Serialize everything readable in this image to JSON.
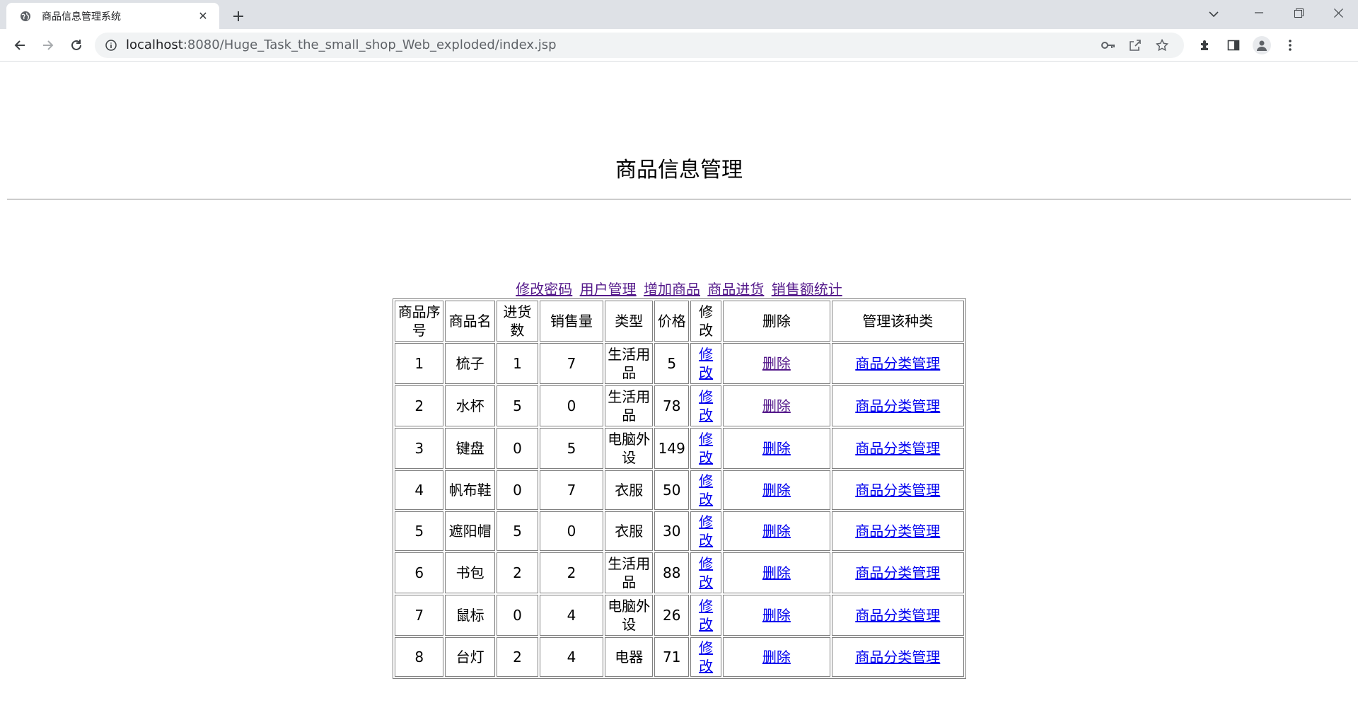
{
  "browser": {
    "tab_title": "商品信息管理系统",
    "url_host": "localhost",
    "url_rest": ":8080/Huge_Task_the_small_shop_Web_exploded/index.jsp",
    "icons": [
      "globe-icon",
      "close-icon",
      "plus-icon",
      "chevron-down-icon",
      "minimize-icon",
      "restore-icon",
      "close-window-icon",
      "back-arrow-icon",
      "forward-arrow-icon",
      "reload-icon",
      "info-icon",
      "key-icon",
      "share-icon",
      "star-icon",
      "extensions-icon",
      "side-panel-icon",
      "profile-icon",
      "kebab-menu-icon"
    ]
  },
  "page": {
    "title": "商品信息管理",
    "links": {
      "change_password": "修改密码",
      "user_management": "用户管理",
      "add_goods": "增加商品",
      "goods_purchase": "商品进货",
      "sales_stats": "销售额统计"
    },
    "table": {
      "headers": {
        "id": "商品序号",
        "name": "商品名",
        "purchase": "进货数",
        "sales": "销售量",
        "type": "类型",
        "price": "价格",
        "edit": "修改",
        "delete": "删除",
        "manage": "管理该种类"
      },
      "rows": [
        {
          "id": "1",
          "name": "梳子",
          "purchase": "1",
          "sales": "7",
          "type": "生活用品",
          "price": "5",
          "edit": "修改",
          "delete": "删除",
          "manage": "商品分类管理"
        },
        {
          "id": "2",
          "name": "水杯",
          "purchase": "5",
          "sales": "0",
          "type": "生活用品",
          "price": "78",
          "edit": "修改",
          "delete": "删除",
          "manage": "商品分类管理"
        },
        {
          "id": "3",
          "name": "键盘",
          "purchase": "0",
          "sales": "5",
          "type": "电脑外设",
          "price": "149",
          "edit": "修改",
          "delete": "删除",
          "manage": "商品分类管理"
        },
        {
          "id": "4",
          "name": "帆布鞋",
          "purchase": "0",
          "sales": "7",
          "type": "衣服",
          "price": "50",
          "edit": "修改",
          "delete": "删除",
          "manage": "商品分类管理"
        },
        {
          "id": "5",
          "name": "遮阳帽",
          "purchase": "5",
          "sales": "0",
          "type": "衣服",
          "price": "30",
          "edit": "修改",
          "delete": "删除",
          "manage": "商品分类管理"
        },
        {
          "id": "6",
          "name": "书包",
          "purchase": "2",
          "sales": "2",
          "type": "生活用品",
          "price": "88",
          "edit": "修改",
          "delete": "删除",
          "manage": "商品分类管理"
        },
        {
          "id": "7",
          "name": "鼠标",
          "purchase": "0",
          "sales": "4",
          "type": "电脑外设",
          "price": "26",
          "edit": "修改",
          "delete": "删除",
          "manage": "商品分类管理"
        },
        {
          "id": "8",
          "name": "台灯",
          "purchase": "2",
          "sales": "4",
          "type": "电器",
          "price": "71",
          "edit": "修改",
          "delete": "删除",
          "manage": "商品分类管理"
        }
      ]
    }
  }
}
